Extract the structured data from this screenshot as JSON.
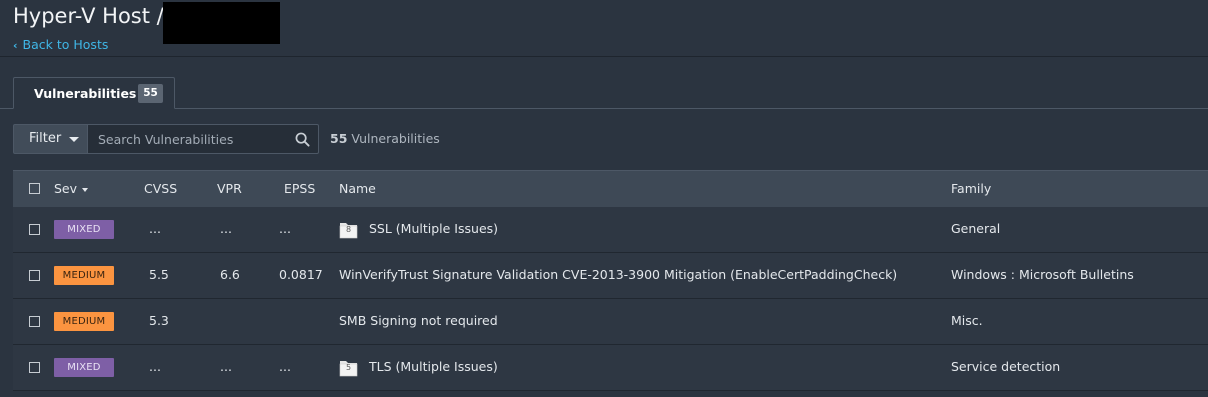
{
  "header": {
    "title": "Hyper-V Host /",
    "back_link": "Back to Hosts"
  },
  "tabs": [
    {
      "label": "Vulnerabilities",
      "count": "55"
    }
  ],
  "toolbar": {
    "filter_label": "Filter",
    "search_placeholder": "Search Vulnerabilities",
    "result_count": "55",
    "result_label": " Vulnerabilities"
  },
  "table": {
    "columns": [
      "Sev",
      "CVSS",
      "VPR",
      "EPSS",
      "Name",
      "Family"
    ],
    "rows": [
      {
        "severity": "MIXED",
        "severity_type": "mixed",
        "cvss": "...",
        "vpr": "...",
        "epss": "...",
        "group_count": "8",
        "name": "SSL (Multiple Issues)",
        "family": "General"
      },
      {
        "severity": "MEDIUM",
        "severity_type": "medium",
        "cvss": "5.5",
        "vpr": "6.6",
        "epss": "0.0817",
        "group_count": "",
        "name": "WinVerifyTrust Signature Validation CVE-2013-3900 Mitigation (EnableCertPaddingCheck)",
        "family": "Windows : Microsoft Bulletins"
      },
      {
        "severity": "MEDIUM",
        "severity_type": "medium",
        "cvss": "5.3",
        "vpr": "",
        "epss": "",
        "group_count": "",
        "name": "SMB Signing not required",
        "family": "Misc."
      },
      {
        "severity": "MIXED",
        "severity_type": "mixed",
        "cvss": "...",
        "vpr": "...",
        "epss": "...",
        "group_count": "5",
        "name": "TLS (Multiple Issues)",
        "family": "Service detection"
      }
    ]
  },
  "colors": {
    "background": "#2b3440",
    "accent_link": "#3fb6e6",
    "mixed": "#7e5fa6",
    "medium": "#fb9440"
  },
  "icons": {
    "back": "chevron-left-icon",
    "filter_caret": "caret-down-icon",
    "search": "search-icon",
    "group": "folder-icon"
  }
}
